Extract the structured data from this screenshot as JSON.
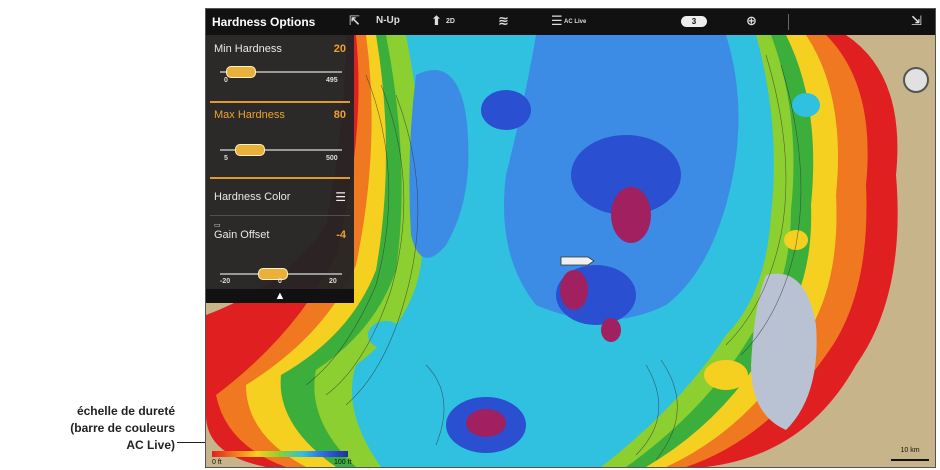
{
  "toolbar": {
    "title": "Hardness Options",
    "orientation": "N-Up",
    "view_2d": "2D",
    "ac_live": "AC Live",
    "pill": "3"
  },
  "panel": {
    "min_hardness": {
      "label": "Min Hardness",
      "value": "20",
      "min_tick": "0",
      "max_tick": "495",
      "level": 0.06
    },
    "max_hardness": {
      "label": "Max Hardness",
      "value": "80",
      "min_tick": "5",
      "max_tick": "500",
      "level": 0.16
    },
    "hardness_color": {
      "label": "Hardness Color"
    },
    "gain_offset": {
      "label": "Gain Offset",
      "value": "-4",
      "min_tick": "-20",
      "mid_tick": "0",
      "max_tick": "20",
      "level": 0.4
    },
    "collapse": "▲"
  },
  "map": {
    "colorbar_min": "0 ft",
    "colorbar_max": "100 ft",
    "scale": "10 km"
  },
  "annotation": {
    "line1": "échelle de dureté",
    "line2": "(barre de couleurs",
    "line3": "AC Live)"
  },
  "colors": {
    "accent": "#f0a030",
    "panel_bg": "#242424",
    "hard_red": "#e02020",
    "soft_blue": "#2030a0"
  }
}
